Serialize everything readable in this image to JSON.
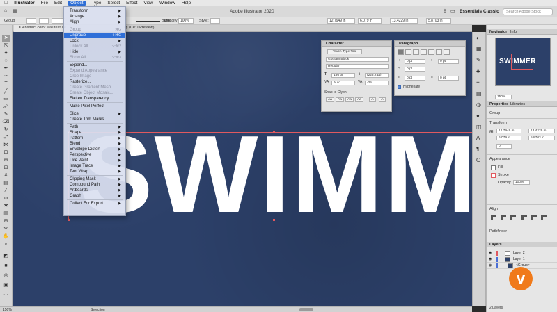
{
  "menubar": {
    "app": "Illustrator",
    "items": [
      "File",
      "Edit",
      "Object",
      "Type",
      "Select",
      "Effect",
      "View",
      "Window",
      "Help"
    ],
    "active": "Object"
  },
  "titlebar": {
    "title": "Adobe Illustrator 2020",
    "workspace": "Essentials Classic",
    "search_placeholder": "Search Adobe Stock"
  },
  "controlbar": {
    "group": "Group",
    "stroke_style": "Basic",
    "opacity_label": "Opacity:",
    "opacity": "100%",
    "style_label": "Style:",
    "x": "12.7949 in",
    "y": "6.079 in",
    "w": "13.4229 in",
    "h": "5.8703 in"
  },
  "document": {
    "tab": "Abstract color wall texture",
    "preview": "@ (CPU Preview)",
    "headline": "SWIMMER"
  },
  "object_menu": {
    "items": [
      {
        "label": "Transform",
        "submenu": true
      },
      {
        "label": "Arrange",
        "submenu": true
      },
      {
        "label": "Align",
        "submenu": true
      },
      {
        "sep": true
      },
      {
        "label": "Group",
        "shortcut": "⌘G",
        "disabled": true
      },
      {
        "label": "Ungroup",
        "shortcut": "⇧⌘G",
        "highlight": true
      },
      {
        "label": "Lock",
        "submenu": true
      },
      {
        "label": "Unlock All",
        "shortcut": "⌥⌘2",
        "disabled": true
      },
      {
        "label": "Hide",
        "submenu": true
      },
      {
        "label": "Show All",
        "shortcut": "⌥⌘3",
        "disabled": true
      },
      {
        "sep": true
      },
      {
        "label": "Expand..."
      },
      {
        "label": "Expand Appearance",
        "disabled": true
      },
      {
        "label": "Crop Image",
        "disabled": true
      },
      {
        "label": "Rasterize..."
      },
      {
        "label": "Create Gradient Mesh...",
        "disabled": true
      },
      {
        "label": "Create Object Mosaic...",
        "disabled": true
      },
      {
        "label": "Flatten Transparency..."
      },
      {
        "sep": true
      },
      {
        "label": "Make Pixel Perfect"
      },
      {
        "sep": true
      },
      {
        "label": "Slice",
        "submenu": true
      },
      {
        "label": "Create Trim Marks"
      },
      {
        "sep": true
      },
      {
        "label": "Path",
        "submenu": true
      },
      {
        "label": "Shape",
        "submenu": true
      },
      {
        "label": "Pattern",
        "submenu": true
      },
      {
        "label": "Blend",
        "submenu": true
      },
      {
        "label": "Envelope Distort",
        "submenu": true
      },
      {
        "label": "Perspective",
        "submenu": true
      },
      {
        "label": "Live Paint",
        "submenu": true
      },
      {
        "label": "Image Trace",
        "submenu": true
      },
      {
        "label": "Text Wrap",
        "submenu": true
      },
      {
        "sep": true
      },
      {
        "label": "Clipping Mask",
        "submenu": true
      },
      {
        "label": "Compound Path",
        "submenu": true
      },
      {
        "label": "Artboards",
        "submenu": true
      },
      {
        "label": "Graph",
        "submenu": true
      },
      {
        "sep": true
      },
      {
        "label": "Collect For Export",
        "submenu": true
      }
    ]
  },
  "character_panel": {
    "title": "Character",
    "touch_tool": "Touch Type Tool",
    "font": "Gotham Black",
    "style": "Regular",
    "size": "186 pt",
    "leading": "(223.2 pt)",
    "kerning": "Auto",
    "tracking": "-25",
    "snap": "Snap to Glyph"
  },
  "paragraph_panel": {
    "title": "Paragraph",
    "indent_left": "0 pt",
    "indent_right": "0 pt",
    "first_line": "0 pt",
    "space_before": "0 pt",
    "space_after": "0 pt",
    "hyphenate": "Hyphenate"
  },
  "right_panel": {
    "navigator_tab": "Navigator",
    "info_tab": "Info",
    "zoom": "150%",
    "properties_tab": "Properties",
    "libraries_tab": "Libraries",
    "group": "Group",
    "transform": "Transform",
    "x": "12.7949 in",
    "y": "6.079 in",
    "w": "13.4229 in",
    "h": "5.8703 in",
    "angle": "0°",
    "appearance": "Appearance",
    "fill": "Fill",
    "stroke": "Stroke",
    "opacity_label": "Opacity",
    "opacity": "100%",
    "align": "Align",
    "pathfinder": "Pathfinder",
    "layers_tab": "Layers",
    "layers": [
      "Layer 2",
      "Layer 1",
      "<Group>"
    ],
    "layers_count": "2 Layers"
  },
  "statusbar": {
    "zoom": "150%",
    "tool": "Selection"
  },
  "colors": {
    "canvas": "#2c4069",
    "selection": "#e0595f",
    "menu_highlight": "#2f6fd8",
    "badge": "#f07a1a"
  }
}
